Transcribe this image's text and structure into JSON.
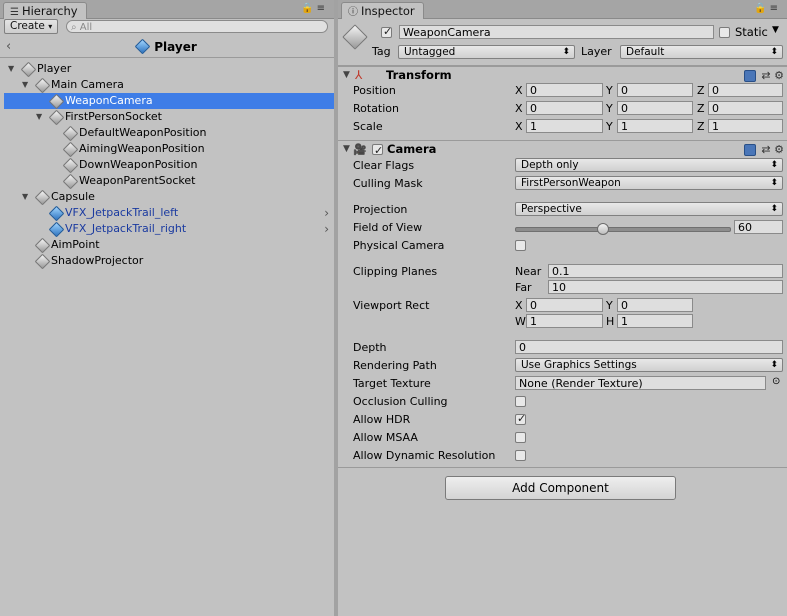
{
  "hierarchy": {
    "tab_label": "Hierarchy",
    "create_label": "Create",
    "search_placeholder": "All",
    "scene_title": "Player",
    "nodes": [
      {
        "label": "Player"
      },
      {
        "label": "Main Camera"
      },
      {
        "label": "WeaponCamera"
      },
      {
        "label": "FirstPersonSocket"
      },
      {
        "label": "DefaultWeaponPosition"
      },
      {
        "label": "AimingWeaponPosition"
      },
      {
        "label": "DownWeaponPosition"
      },
      {
        "label": "WeaponParentSocket"
      },
      {
        "label": "Capsule"
      },
      {
        "label": "VFX_JetpackTrail_left"
      },
      {
        "label": "VFX_JetpackTrail_right"
      },
      {
        "label": "AimPoint"
      },
      {
        "label": "ShadowProjector"
      }
    ]
  },
  "inspector": {
    "tab_label": "Inspector",
    "object_name": "WeaponCamera",
    "static_label": "Static",
    "tag_label": "Tag",
    "tag_value": "Untagged",
    "layer_label": "Layer",
    "layer_value": "Default",
    "transform": {
      "title": "Transform",
      "position_label": "Position",
      "rotation_label": "Rotation",
      "scale_label": "Scale",
      "x": "X",
      "y": "Y",
      "z": "Z",
      "position": [
        "0",
        "0",
        "0"
      ],
      "rotation": [
        "0",
        "0",
        "0"
      ],
      "scale": [
        "1",
        "1",
        "1"
      ]
    },
    "camera": {
      "title": "Camera",
      "clear_flags_label": "Clear Flags",
      "clear_flags_value": "Depth only",
      "culling_mask_label": "Culling Mask",
      "culling_mask_value": "FirstPersonWeapon",
      "projection_label": "Projection",
      "projection_value": "Perspective",
      "fov_label": "Field of View",
      "fov_value": "60",
      "fov_fraction": 0.4,
      "physical_camera_label": "Physical Camera",
      "clipping_planes_label": "Clipping Planes",
      "near_label": "Near",
      "near_value": "0.1",
      "far_label": "Far",
      "far_value": "10",
      "viewport_rect_label": "Viewport Rect",
      "x_label": "X",
      "y_label": "Y",
      "w_label": "W",
      "h_label": "H",
      "viewport_x": "0",
      "viewport_y": "0",
      "viewport_w": "1",
      "viewport_h": "1",
      "depth_label": "Depth",
      "depth_value": "0",
      "rendering_path_label": "Rendering Path",
      "rendering_path_value": "Use Graphics Settings",
      "target_texture_label": "Target Texture",
      "target_texture_value": "None (Render Texture)",
      "occlusion_culling_label": "Occlusion Culling",
      "allow_hdr_label": "Allow HDR",
      "allow_msaa_label": "Allow MSAA",
      "allow_dynamic_resolution_label": "Allow Dynamic Resolution"
    },
    "add_component_label": "Add Component"
  }
}
